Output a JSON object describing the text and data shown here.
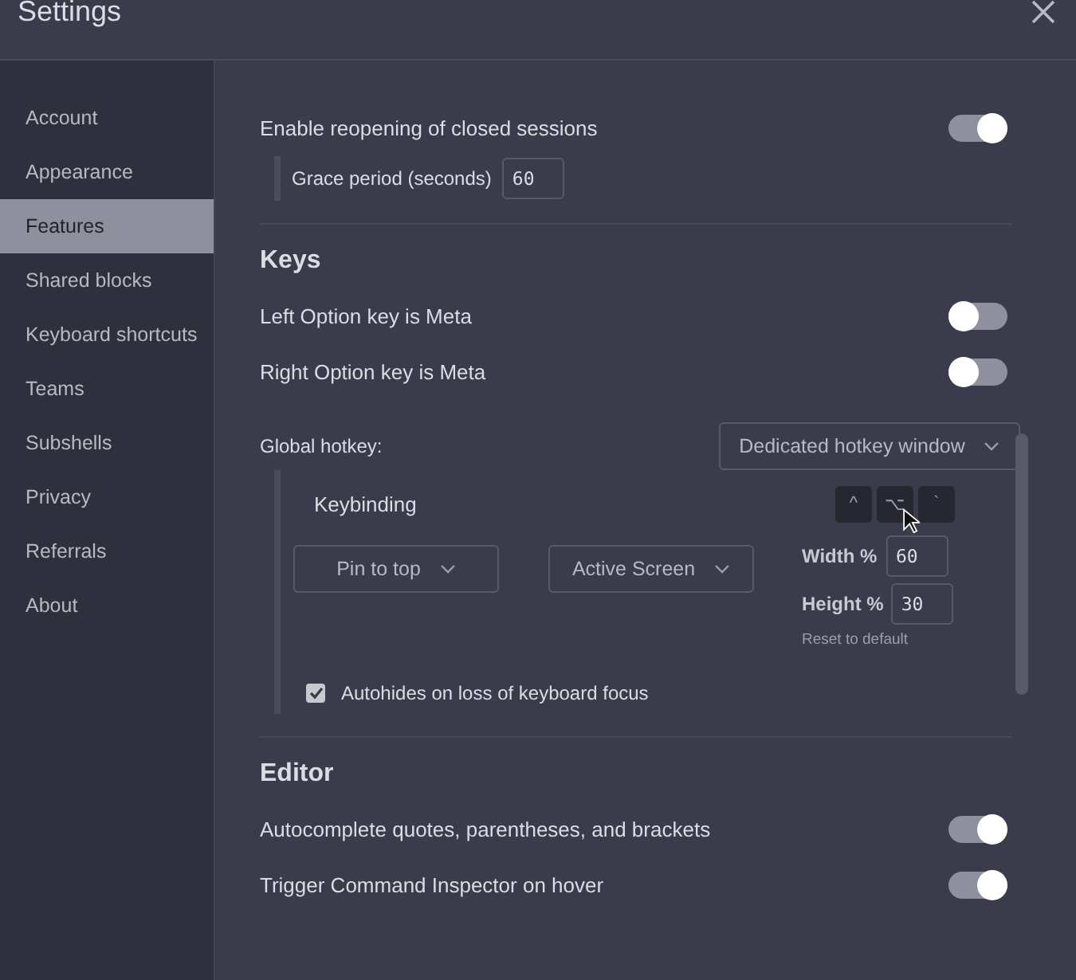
{
  "window": {
    "title": "Settings"
  },
  "sidebar": {
    "items": [
      {
        "label": "Account",
        "selected": false
      },
      {
        "label": "Appearance",
        "selected": false
      },
      {
        "label": "Features",
        "selected": true
      },
      {
        "label": "Shared blocks",
        "selected": false
      },
      {
        "label": "Keyboard shortcuts",
        "selected": false
      },
      {
        "label": "Teams",
        "selected": false
      },
      {
        "label": "Subshells",
        "selected": false
      },
      {
        "label": "Privacy",
        "selected": false
      },
      {
        "label": "Referrals",
        "selected": false
      },
      {
        "label": "About",
        "selected": false
      }
    ]
  },
  "sessions": {
    "toggle": {
      "label": "Enable reopening of closed sessions",
      "on": true
    },
    "grace": {
      "label": "Grace period (seconds)",
      "value": "60"
    }
  },
  "keys": {
    "heading": "Keys",
    "toggles": [
      {
        "label": "Left Option key is Meta",
        "on": false
      },
      {
        "label": "Right Option key is Meta",
        "on": false
      }
    ],
    "global_hotkey": {
      "label": "Global hotkey:",
      "mode": "Dedicated hotkey window",
      "keybinding": {
        "label": "Keybinding",
        "keys": [
          "^",
          "⌥",
          "`"
        ]
      },
      "position": "Pin to top",
      "screen": "Active Screen",
      "width": {
        "label": "Width %",
        "value": "60"
      },
      "height": {
        "label": "Height %",
        "value": "30"
      },
      "reset": "Reset to default",
      "autohide": {
        "label": "Autohides on loss of keyboard focus",
        "checked": true
      }
    }
  },
  "editor": {
    "heading": "Editor",
    "toggles": [
      {
        "label": "Autocomplete quotes, parentheses, and brackets",
        "on": true
      },
      {
        "label": "Trigger Command Inspector on hover",
        "on": true
      }
    ]
  }
}
